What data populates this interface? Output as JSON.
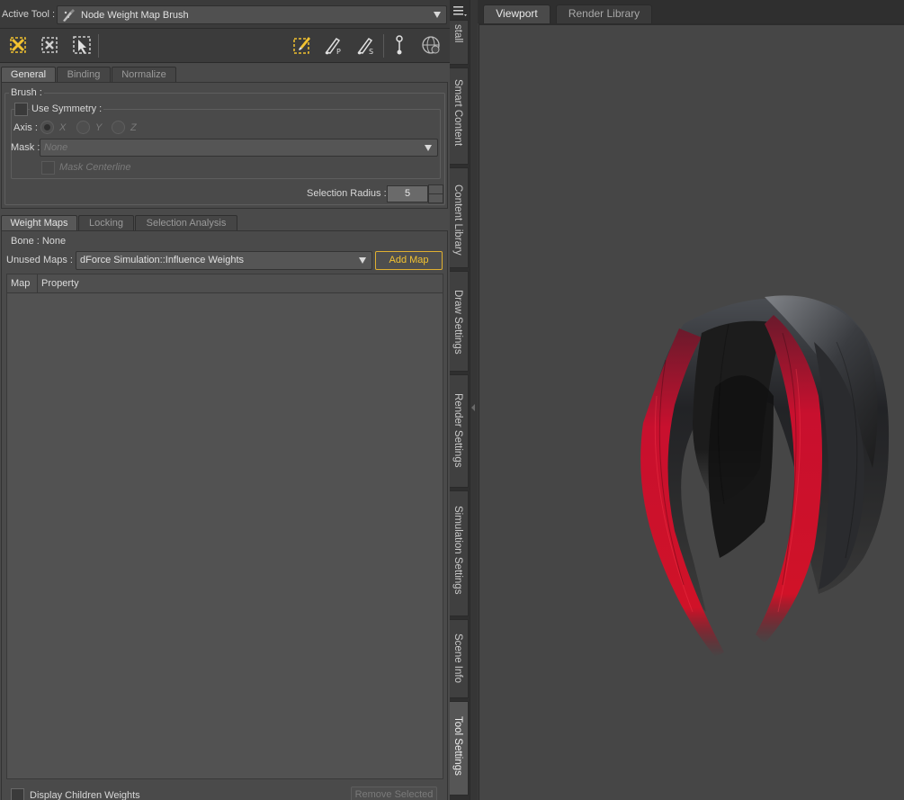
{
  "active_tool": {
    "label": "Active Tool :",
    "value": "Node Weight Map Brush"
  },
  "tool_tabs": [
    "General",
    "Binding",
    "Normalize"
  ],
  "brush": {
    "group_label": "Brush :",
    "use_symmetry_label": "Use Symmetry :",
    "axis_label": "Axis :",
    "axes": [
      "X",
      "Y",
      "Z"
    ],
    "mask_label": "Mask :",
    "mask_value": "None",
    "mask_centerline_label": "Mask Centerline",
    "selection_radius_label": "Selection Radius :",
    "selection_radius_value": "5"
  },
  "map_tabs": [
    "Weight Maps",
    "Locking",
    "Selection Analysis"
  ],
  "weight_maps": {
    "bone_label": "Bone : None",
    "unused_maps_label": "Unused Maps :",
    "unused_maps_value": "dForce Simulation::Influence Weights",
    "add_map_label": "Add Map",
    "columns": [
      "Map",
      "Property"
    ],
    "display_children_label": "Display Children Weights",
    "remove_selected_label": "Remove Selected"
  },
  "side_tabs": [
    "stall",
    "Smart Content",
    "Content Library",
    "Draw Settings",
    "Render Settings",
    "Simulation Settings",
    "Scene Info",
    "Tool Settings"
  ],
  "viewport_tabs": [
    "Viewport",
    "Render Library"
  ],
  "colors": {
    "accent": "#f2c230",
    "panel": "#4a4a4a",
    "viewport": "#464646",
    "hair_red": "#c8102e",
    "hair_black": "#1c1c1c"
  }
}
